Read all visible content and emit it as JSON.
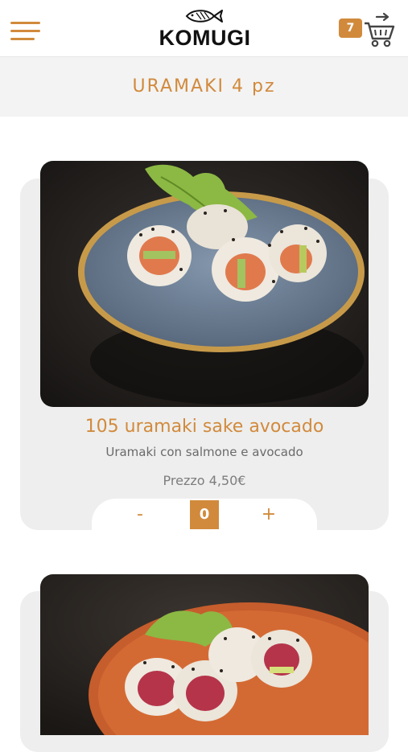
{
  "header": {
    "menu_icon": "hamburger-menu-icon",
    "logo_text": "KOMUGI",
    "logo_icon": "fish-icon",
    "cart_count": "7",
    "cart_icon": "shopping-cart-icon"
  },
  "category": {
    "title": "URAMAKI 4 pz"
  },
  "products": [
    {
      "name": "105 uramaki sake avocado",
      "description": "Uramaki con salmone e avocado",
      "price": "Prezzo 4,50€",
      "minus_label": "-",
      "quantity": "0",
      "plus_label": "+"
    }
  ],
  "colors": {
    "accent": "#d18a3c",
    "band": "#f3f3f3",
    "card": "#eeeeee"
  }
}
